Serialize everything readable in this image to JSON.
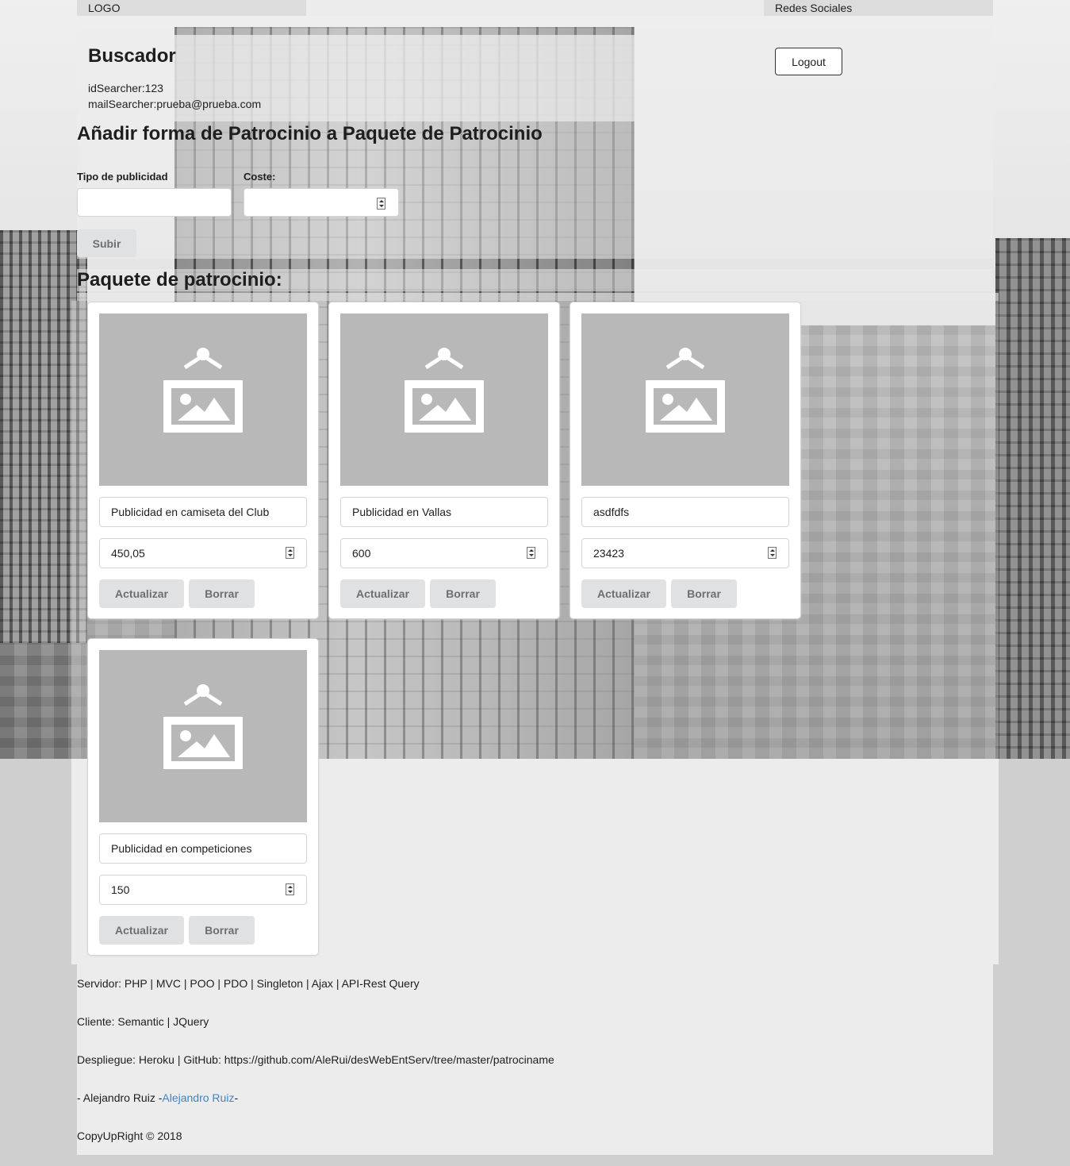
{
  "topbar": {
    "logo": "LOGO",
    "social": "Redes Sociales"
  },
  "header": {
    "title": "Buscador",
    "id_line": "idSearcher:123",
    "mail_line": "mailSearcher:prueba@prueba.com",
    "logout_label": "Logout"
  },
  "form": {
    "title": "Añadir forma de Patrocinio a Paquete de Patrocinio",
    "type_label": "Tipo de publicidad",
    "type_value": "",
    "cost_label": "Coste:",
    "cost_value": "",
    "submit_label": "Subir"
  },
  "package": {
    "title": "Paquete de patrocinio:",
    "update_label": "Actualizar",
    "delete_label": "Borrar",
    "items": [
      {
        "name": "Publicidad en camiseta del Club",
        "cost": "450,05",
        "image_icon": "image-placeholder-icon"
      },
      {
        "name": "Publicidad en Vallas",
        "cost": "600",
        "image_icon": "image-placeholder-icon"
      },
      {
        "name": "asdfdfs",
        "cost": "23423",
        "image_icon": "image-placeholder-icon"
      },
      {
        "name": "Publicidad en competiciones",
        "cost": "150",
        "image_icon": "image-placeholder-icon"
      }
    ]
  },
  "footer": {
    "server": "Servidor: PHP | MVC | POO | PDO | Singleton | Ajax | API-Rest Query",
    "client": "Cliente: Semantic | JQuery",
    "deploy": "Despliegue: Heroku | GitHub: https://github.com/AleRui/desWebEntServ/tree/master/patrociname",
    "author_prefix": "- Alejandro Ruiz -",
    "author_link": "Alejandro Ruiz",
    "author_suffix": "-",
    "copyright": "CopyUpRight © 2018"
  },
  "colors": {
    "panel": "#ececec",
    "button_bg": "#e0e1e2",
    "button_text": "#6f6f6f",
    "image_placeholder": "#b8b8b8",
    "link": "#4183c4"
  }
}
